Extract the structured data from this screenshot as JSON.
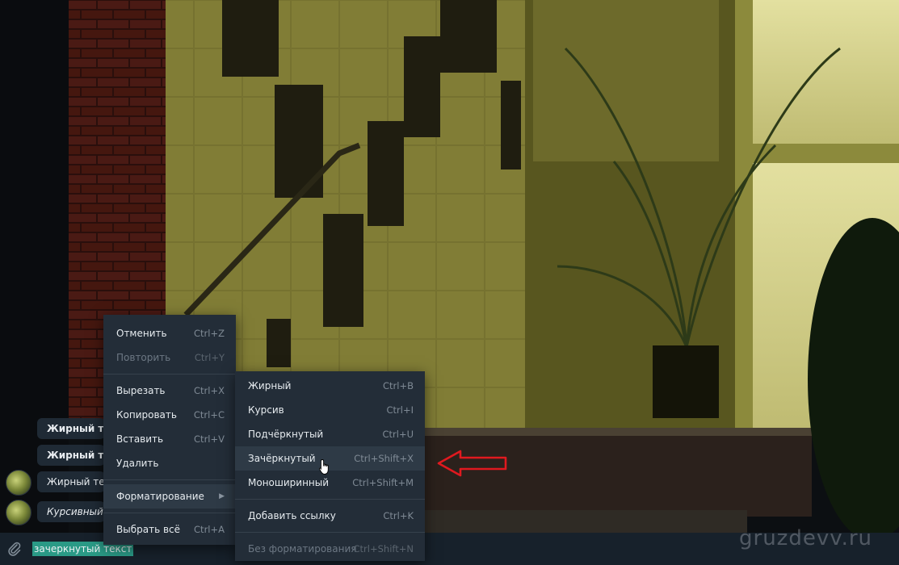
{
  "chat": {
    "messages": [
      {
        "text": "Жирный текс",
        "style": "bold"
      },
      {
        "text": "Жирный текс",
        "style": "bold"
      },
      {
        "text": "Жирный тек",
        "style": "normal"
      },
      {
        "text": "Курсивный т",
        "style": "italic"
      }
    ]
  },
  "composer": {
    "input_value": "зачеркнутый текст"
  },
  "context_menu": {
    "items": [
      {
        "label": "Отменить",
        "shortcut": "Ctrl+Z"
      },
      {
        "label": "Повторить",
        "shortcut": "Ctrl+Y"
      },
      {
        "label": "Вырезать",
        "shortcut": "Ctrl+X"
      },
      {
        "label": "Копировать",
        "shortcut": "Ctrl+C"
      },
      {
        "label": "Вставить",
        "shortcut": "Ctrl+V"
      },
      {
        "label": "Удалить",
        "shortcut": ""
      },
      {
        "label": "Форматирование",
        "shortcut": ""
      },
      {
        "label": "Выбрать всё",
        "shortcut": "Ctrl+A"
      }
    ]
  },
  "format_menu": {
    "items": [
      {
        "label": "Жирный",
        "shortcut": "Ctrl+B"
      },
      {
        "label": "Курсив",
        "shortcut": "Ctrl+I"
      },
      {
        "label": "Подчёркнутый",
        "shortcut": "Ctrl+U"
      },
      {
        "label": "Зачёркнутый",
        "shortcut": "Ctrl+Shift+X"
      },
      {
        "label": "Моноширинный",
        "shortcut": "Ctrl+Shift+M"
      },
      {
        "label": "Добавить ссылку",
        "shortcut": "Ctrl+K"
      },
      {
        "label": "Без форматирования",
        "shortcut": "Ctrl+Shift+N"
      }
    ]
  },
  "watermark": "gruzdevv.ru",
  "colors": {
    "menu_bg": "#232d38",
    "composer_bg": "#17212b",
    "selection": "#2a9a86",
    "arrow_red": "#e0191f"
  },
  "icons": [
    "paperclip-icon",
    "submenu-arrow-icon",
    "mouse-cursor-icon",
    "red-arrow-icon"
  ]
}
